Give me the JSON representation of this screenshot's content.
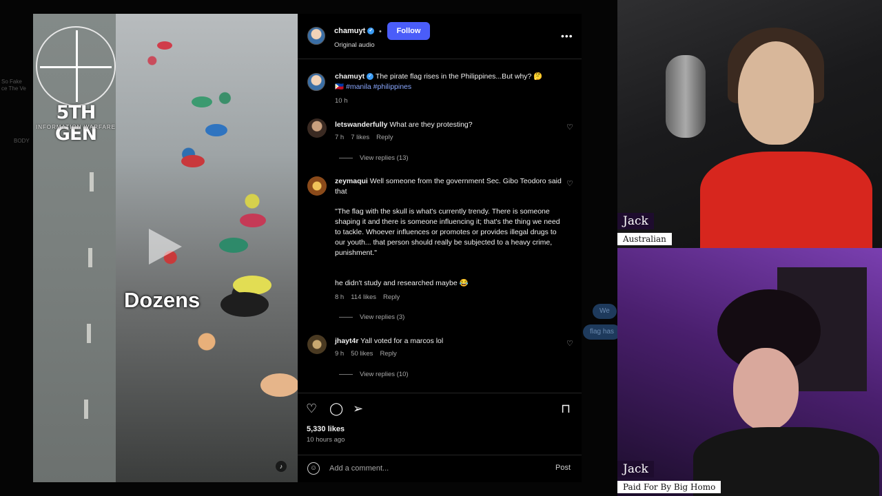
{
  "video": {
    "logo_title": "5TH GEN",
    "logo_subtitle": "INFORMATION WARFARE",
    "caption": "Dozens"
  },
  "post": {
    "username": "chamuyt",
    "follow_label": "Follow",
    "audio": "Original audio",
    "more_icon": "more-horizontal-icon",
    "caption_text": "The pirate flag rises in the Philippines...But why? 🤔",
    "caption_tags": "🇵🇭 #manila #philippines",
    "caption_time": "10 h",
    "comments": [
      {
        "user": "letswanderfully",
        "text": "What are they protesting?",
        "time": "7 h",
        "likes": "7 likes",
        "reply": "Reply",
        "replies": "View replies (13)"
      },
      {
        "user": "zeymaqui",
        "text": "Well someone from the government Sec. Gibo Teodoro said that",
        "quote": "\"The flag with the skull is what's currently trendy. There is someone shaping it and there is someone influencing it; that's the thing we need to tackle. Whoever influences or promotes or provides illegal drugs to our youth... that person should really be subjected to a heavy crime, punishment.\"",
        "extra": "he didn't study and researched maybe 😂",
        "time": "8 h",
        "likes": "114 likes",
        "reply": "Reply",
        "replies": "View replies (3)"
      },
      {
        "user": "jhayt4r",
        "text": "Yall voted for a marcos lol",
        "time": "9 h",
        "likes": "50 likes",
        "reply": "Reply",
        "replies": "View replies (10)"
      }
    ],
    "likes": "5,330 likes",
    "ago": "10 hours ago",
    "comment_placeholder": "Add a comment...",
    "post_label": "Post"
  },
  "bubbles": [
    "We",
    "flag has"
  ],
  "cams": [
    {
      "name": "Jack",
      "role": "Australian"
    },
    {
      "name": "Jack",
      "role": "Paid For By Big Homo"
    }
  ],
  "backdrop": {
    "ghost1": "So Fake",
    "ghost2": "ce The Ve",
    "ghost3": "BODY"
  }
}
